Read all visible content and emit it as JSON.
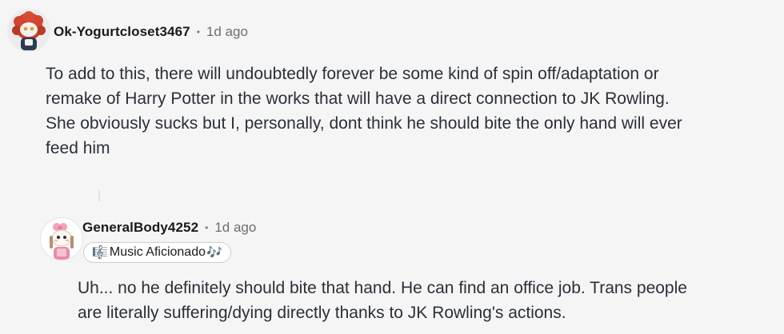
{
  "comments": [
    {
      "username": "Ok-Yogurtcloset3467",
      "separator": "•",
      "time": "1d ago",
      "avatar_icon": "snoo-avatar-red-hair-icon",
      "body_lines": [
        "To add to this, there will undoubtedly forever be some kind of spin off/adaptation or",
        "remake of Harry Potter in the works that will have a direct connection to JK Rowling.",
        "She obviously sucks but I, personally, dont think he should bite the only hand will ever",
        "feed him"
      ]
    },
    {
      "username": "GeneralBody4252",
      "separator": "•",
      "time": "1d ago",
      "avatar_icon": "snoo-avatar-pink-bow-icon",
      "flair": {
        "left_icon": "🎼",
        "text": "Music Aficionado",
        "right_icon": "🎶"
      },
      "body_lines": [
        "Uh... no he definitely should bite that hand. He can find an office job. Trans people",
        "are literally suffering/dying directly thanks to JK Rowling's actions."
      ]
    }
  ]
}
